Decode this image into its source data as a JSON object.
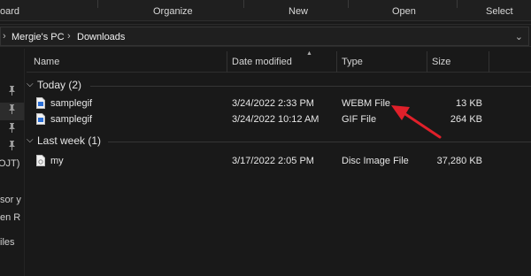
{
  "ribbon": {
    "groups": [
      "oard",
      "Organize",
      "New",
      "Open",
      "Select"
    ]
  },
  "address": {
    "crumbs": [
      "Mergie's PC",
      "Downloads"
    ]
  },
  "nav": {
    "fragments": [
      "OJT)",
      "sor y",
      "en R",
      "iles"
    ]
  },
  "columns": {
    "name": "Name",
    "date": "Date modified",
    "type": "Type",
    "size": "Size"
  },
  "groups": [
    {
      "label": "Today (2)",
      "files": [
        {
          "name": "samplegif",
          "date": "3/24/2022 2:33 PM",
          "type": "WEBM File",
          "size": "13 KB",
          "icon": "webm-file-icon"
        },
        {
          "name": "samplegif",
          "date": "3/24/2022 10:12 AM",
          "type": "GIF File",
          "size": "264 KB",
          "icon": "gif-file-icon"
        }
      ]
    },
    {
      "label": "Last week (1)",
      "files": [
        {
          "name": "my",
          "date": "3/17/2022 2:05 PM",
          "type": "Disc Image File",
          "size": "37,280 KB",
          "icon": "disc-image-file-icon"
        }
      ]
    }
  ],
  "annotation": {
    "arrow_color": "#e0202a"
  }
}
